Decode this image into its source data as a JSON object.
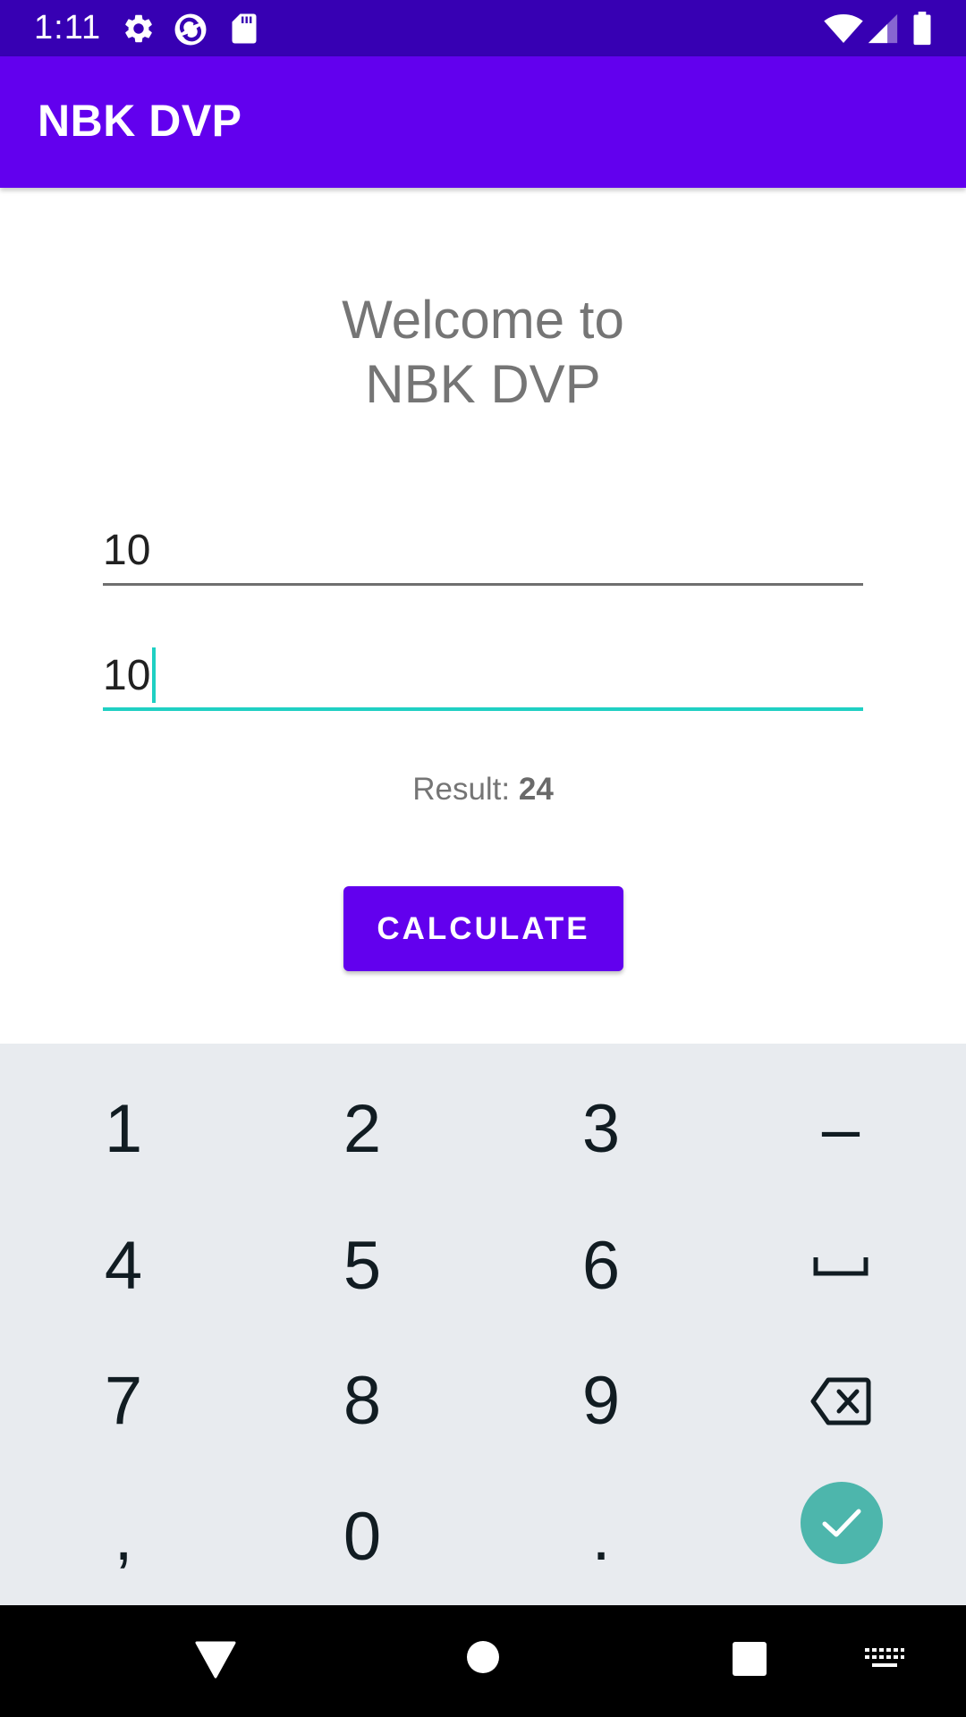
{
  "status_bar": {
    "time": "1:11",
    "left_icons": [
      "gear-icon",
      "sync-icon",
      "sd-card-icon"
    ],
    "right_icons": [
      "wifi-icon",
      "cell-signal-icon",
      "battery-icon"
    ]
  },
  "app_bar": {
    "title": "NBK DVP"
  },
  "main": {
    "welcome_line1": "Welcome to",
    "welcome_line2": "NBK DVP",
    "field1_value": "10",
    "field2_value": "10",
    "result_label": "Result: ",
    "result_value": "24",
    "calculate_label": "CALCULATE"
  },
  "keyboard": {
    "keys": [
      "1",
      "2",
      "3",
      "-",
      "4",
      "5",
      "6",
      "␣",
      "7",
      "8",
      "9",
      "⌫",
      ",",
      "0",
      ".",
      "✓"
    ],
    "k1": "1",
    "k2": "2",
    "k3": "3",
    "k_minus": "–",
    "k4": "4",
    "k5": "5",
    "k6": "6",
    "k7": "7",
    "k8": "8",
    "k9": "9",
    "k_comma": ",",
    "k0": "0",
    "k_period": ".",
    "done_color": "#4db6ac"
  },
  "nav_bar": {
    "icons": [
      "back-icon",
      "home-icon",
      "recents-icon",
      "keyboard-switch-icon"
    ]
  },
  "colors": {
    "status_bar": "#3700b3",
    "primary": "#6200ee",
    "accent": "#1fd0c3",
    "text_secondary": "#757575"
  }
}
